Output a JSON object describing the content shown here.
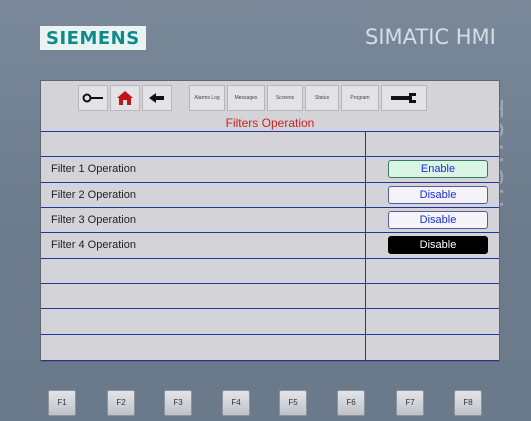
{
  "device": {
    "brand": "SIEMENS",
    "product": "SIMATIC HMI",
    "side_label": "TOUCH"
  },
  "toolbar": {
    "buttons": [
      {
        "icon": "key-icon",
        "label": ""
      },
      {
        "icon": "home-icon",
        "label": ""
      },
      {
        "icon": "back-arrow-icon",
        "label": ""
      },
      {
        "icon": "",
        "label": "Alarms Log"
      },
      {
        "icon": "",
        "label": "Messages"
      },
      {
        "icon": "",
        "label": "Screens"
      },
      {
        "icon": "",
        "label": "Status"
      },
      {
        "icon": "",
        "label": "Program"
      },
      {
        "icon": "wrench-icon",
        "label": ""
      }
    ]
  },
  "screen": {
    "title": "Filters Operation",
    "rows": [
      {
        "label": "Filter 1 Operation",
        "button": "Enable",
        "style": "enable"
      },
      {
        "label": "Filter 2 Operation",
        "button": "Disable",
        "style": "disable"
      },
      {
        "label": "Filter 3 Operation",
        "button": "Disable",
        "style": "disable"
      },
      {
        "label": "Filter 4 Operation",
        "button": "Disable",
        "style": "dark"
      }
    ]
  },
  "function_keys": [
    "F1",
    "F2",
    "F3",
    "F4",
    "F5",
    "F6",
    "F7",
    "F8"
  ]
}
